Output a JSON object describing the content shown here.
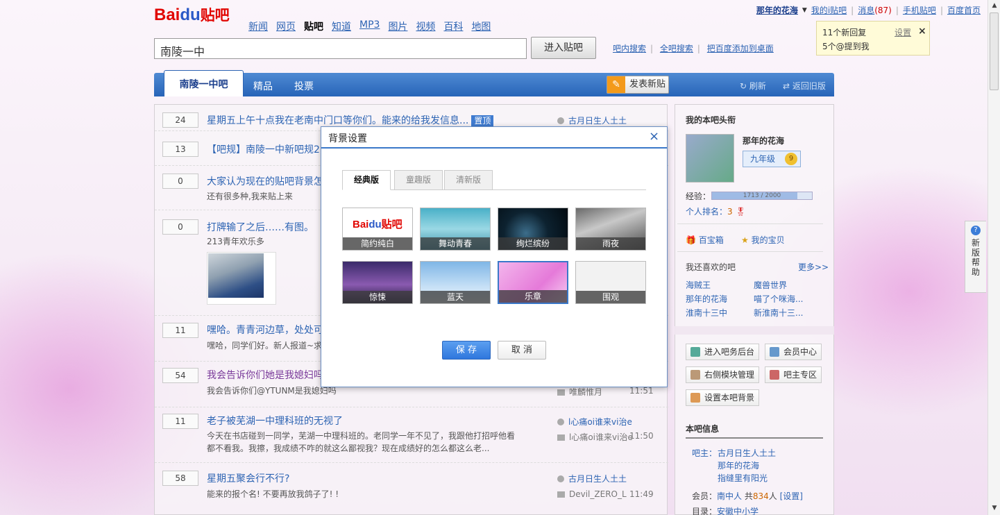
{
  "header": {
    "logo_bai": "Bai",
    "logo_du": "du",
    "logo_tieba": "贴吧",
    "nav": [
      "新闻",
      "网页",
      "贴吧",
      "知道",
      "MP3",
      "图片",
      "视频",
      "百科",
      "地图"
    ],
    "search_value": "南陵一中",
    "enter_btn": "进入贴吧",
    "links": [
      "吧内搜索",
      "全吧搜索",
      "把百度添加到桌面"
    ]
  },
  "userbar": {
    "username": "那年的花海",
    "my_i": "我的i贴吧",
    "msg": "消息",
    "msg_count": "(87)",
    "mobile": "手机贴吧",
    "home": "百度首页"
  },
  "notice": {
    "line1": "11个新回复",
    "line2": "5个@提到我",
    "setting": "设置",
    "close": "×"
  },
  "tabs": {
    "active": "南陵一中吧",
    "t2": "精品",
    "t3": "投票",
    "post_btn": "发表新贴",
    "refresh": "刷新",
    "old": "返回旧版"
  },
  "threads": [
    {
      "count": "24",
      "title": "星期五上午十点我在老南中门口等你们。能来的给我发信息...",
      "badge": "置顶",
      "author": "古月日生人土土"
    },
    {
      "count": "13",
      "title": "【吧规】南陵一中新吧规2"
    },
    {
      "count": "0",
      "title": "大家认为现在的贴吧背景怎",
      "sub": "还有很多种,我来贴上来"
    },
    {
      "count": "0",
      "title": "打牌输了之后……有图。",
      "sub": "213青年欢乐多"
    },
    {
      "count": "11",
      "title": "嘿哈。青青河边草，处处可",
      "sub": "嘿哈，同学们好。新人报道~求"
    },
    {
      "count": "54",
      "title": "我会告诉你们她是我媳妇吗",
      "sub": "我会告诉你们@YTUNM是我媳妇吗",
      "author2": "唯麟惟月",
      "time": "11:51"
    },
    {
      "count": "11",
      "title": "老子被芜湖一中理科班的无视了",
      "sub1": "今天在书店碰到一同学，芜湖一中理科班的。老同学一年不见了，我跟他打招呼他看",
      "sub2": "都不看我。我擦，我成绩不咋的就这么鄙视我？现在成绩好的怎么都这么老...",
      "author": "l心痛oi谁来vi治e",
      "author2": "l心痛oi谁来vi治e",
      "time": "11:50"
    },
    {
      "count": "58",
      "title": "星期五聚会行不行?",
      "sub": "能来的报个名! 不要再放我鸽子了! !",
      "author": "古月日生人土土",
      "author2": "Devil_ZERO_L",
      "time": "11:49"
    }
  ],
  "sidebar": {
    "title": "我的本吧头衔",
    "name": "那年的花海",
    "level": "九年级",
    "level_num": "9",
    "exp_label": "经验：",
    "exp": "1713 / 2000",
    "exp_fraction": 0.8565,
    "rank_label": "个人排名：",
    "rank": "3",
    "box1": "百宝箱",
    "box2": "我的宝贝",
    "fav_title": "我还喜欢的吧",
    "more": "更多>>",
    "favs": [
      "海贼王",
      "魔兽世界",
      "那年的花海",
      "喵了个咪海...",
      "淮南十三中",
      "新淮南十三..."
    ],
    "btns": [
      "进入吧务后台",
      "会员中心",
      "右侧模块管理",
      "吧主专区",
      "设置本吧背景"
    ],
    "info_title": "本吧信息",
    "owner_label": "吧主：",
    "owners": [
      "古月日生人土土",
      "那年的花海",
      "指缝里有阳光"
    ],
    "member_label": "会员：",
    "member_name": "南中人",
    "member_total": "共",
    "member_count": "834",
    "member_unit": "人",
    "member_set": "[设置]",
    "dir_label": "目录：",
    "dir": "安徽中小学"
  },
  "dialog": {
    "title": "背景设置",
    "close": "×",
    "tabs": [
      "经典版",
      "童趣版",
      "清新版"
    ],
    "themes": [
      "简约纯白",
      "舞动青春",
      "绚烂缤纷",
      "雨夜",
      "惊悚",
      "蓝天",
      "乐章",
      "围观"
    ],
    "thumb_logo_bai": "Bai",
    "thumb_logo_du": "du",
    "thumb_logo_tieba": "贴吧",
    "save": "保 存",
    "cancel": "取 消"
  },
  "help": {
    "q": "?",
    "label": "新版帮助"
  }
}
